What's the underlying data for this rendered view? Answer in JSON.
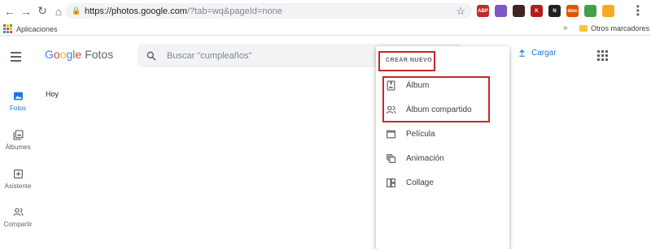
{
  "browser": {
    "url_host": "https://photos.google.com",
    "url_rest": "/?tab=wq&pageId=none",
    "extensions": [
      {
        "icon": "adblock-icon",
        "label": "ABP",
        "color": "#c62828"
      },
      {
        "icon": "feather-icon",
        "label": "",
        "color": "#7e57c2"
      },
      {
        "icon": "shield-icon",
        "label": "",
        "color": "#3e2723"
      },
      {
        "icon": "k-icon",
        "label": "K",
        "color": "#b71c1c"
      },
      {
        "icon": "netflix-icon",
        "label": "N",
        "color": "#212121"
      },
      {
        "icon": "dmc-icon",
        "label": "dmc",
        "color": "#e65100"
      },
      {
        "icon": "ring-icon",
        "label": "",
        "color": "#43a047"
      },
      {
        "icon": "gear-icon",
        "label": "",
        "color": "#f9a825"
      }
    ],
    "bookmarks": {
      "apps_label": "Aplicaciones",
      "more_label": "»",
      "other_label": "Otros marcadores"
    }
  },
  "header": {
    "logo_g": [
      "G",
      "o",
      "o",
      "g",
      "l",
      "e"
    ],
    "logo_colors": [
      "#4285f4",
      "#ea4335",
      "#fbbc05",
      "#4285f4",
      "#34a853",
      "#ea4335"
    ],
    "logo_product": "Fotos",
    "search_placeholder": "Buscar \"cumpleaños\"",
    "upload_label": "Cargar"
  },
  "sidebar": {
    "items": [
      {
        "label": "Fotos",
        "icon": "photo-icon",
        "active": true
      },
      {
        "label": "Álbumes",
        "icon": "albums-icon",
        "active": false
      },
      {
        "label": "Asistente",
        "icon": "assistant-icon",
        "active": false
      },
      {
        "label": "Compartir",
        "icon": "share-people-icon",
        "active": false
      }
    ]
  },
  "main": {
    "section_title": "Hoy"
  },
  "create_menu": {
    "header": "CREAR NUEVO",
    "items": [
      {
        "label": "Álbum",
        "icon": "album-icon"
      },
      {
        "label": "Álbum compartido",
        "icon": "shared-album-icon"
      },
      {
        "label": "Película",
        "icon": "movie-icon"
      },
      {
        "label": "Animación",
        "icon": "animation-icon"
      },
      {
        "label": "Collage",
        "icon": "collage-icon"
      }
    ]
  },
  "colors": {
    "accent": "#1a73e8",
    "highlight": "#c62828",
    "icon_gray": "#5f6368"
  }
}
